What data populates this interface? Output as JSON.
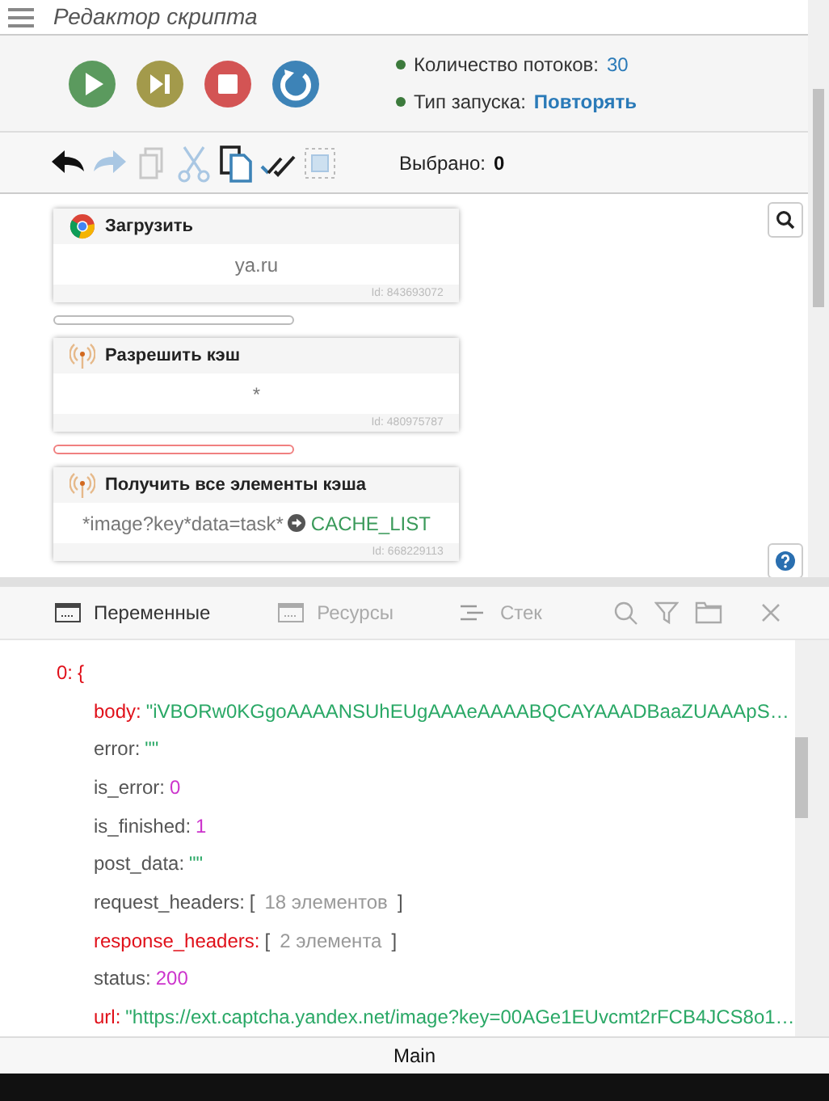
{
  "window": {
    "title": "Редактор скрипта"
  },
  "run_controls": [
    {
      "kind": "play"
    },
    {
      "kind": "step"
    },
    {
      "kind": "stop"
    },
    {
      "kind": "restart"
    }
  ],
  "info": [
    {
      "label": "Количество потоков:",
      "value": "30"
    },
    {
      "label": "Тип запуска:",
      "value": "Повторять"
    }
  ],
  "edit_toolbar": [
    {
      "kind": "undo",
      "disabled": false
    },
    {
      "kind": "redo",
      "disabled": true
    },
    {
      "kind": "copy",
      "disabled": true
    },
    {
      "kind": "cut",
      "disabled": true
    },
    {
      "kind": "paste",
      "disabled": false
    },
    {
      "kind": "check",
      "disabled": false
    },
    {
      "kind": "select",
      "disabled": true
    }
  ],
  "selected": {
    "label": "Выбрано:",
    "value": "0"
  },
  "blocks": [
    {
      "kind": "browser",
      "title": "Загрузить",
      "body": "ya.ru",
      "id": "Id: 843693072",
      "connector_active": false
    },
    {
      "kind": "network",
      "title": "Разрешить кэш",
      "body": "*",
      "id": "Id: 480975787",
      "connector_active": true
    },
    {
      "kind": "network",
      "title": "Получить все элементы кэша",
      "body": "*image?key*data=task*",
      "output": "CACHE_LIST",
      "id": "Id: 668229113"
    }
  ],
  "panel_tabs": [
    {
      "label": "Переменные",
      "selected": true
    },
    {
      "label": "Ресурсы",
      "selected": false
    },
    {
      "label": "Стек",
      "selected": false
    }
  ],
  "variables": [
    {
      "key": "0:",
      "kind": "object",
      "open": "{",
      "changed": true
    },
    {
      "key": "body:",
      "kind": "string",
      "value": "\"iVBORw0KGgoAAAANSUhEUgAAAeAAAABQCAYAAADBaaZUAAApS…",
      "changed": true
    },
    {
      "key": "error:",
      "kind": "string",
      "value": "\"\"",
      "changed": false
    },
    {
      "key": "is_error:",
      "kind": "number",
      "value": "0",
      "changed": false
    },
    {
      "key": "is_finished:",
      "kind": "number",
      "value": "1",
      "changed": false
    },
    {
      "key": "post_data:",
      "kind": "string",
      "value": "\"\"",
      "changed": false
    },
    {
      "key": "request_headers:",
      "kind": "array",
      "open": "[",
      "value": "18 элементов",
      "close": "]",
      "changed": false
    },
    {
      "key": "response_headers:",
      "kind": "array",
      "open": "[",
      "value": "2 элемента",
      "close": "]",
      "changed": true
    },
    {
      "key": "status:",
      "kind": "number",
      "value": "200",
      "changed": false
    },
    {
      "key": "url:",
      "kind": "string",
      "value": "\"https://ext.captcha.yandex.net/image?key=00AGe1EUvcmt2rFCB4JCS8o1…",
      "changed": true
    }
  ],
  "status_bar": {
    "thread": "Main"
  }
}
